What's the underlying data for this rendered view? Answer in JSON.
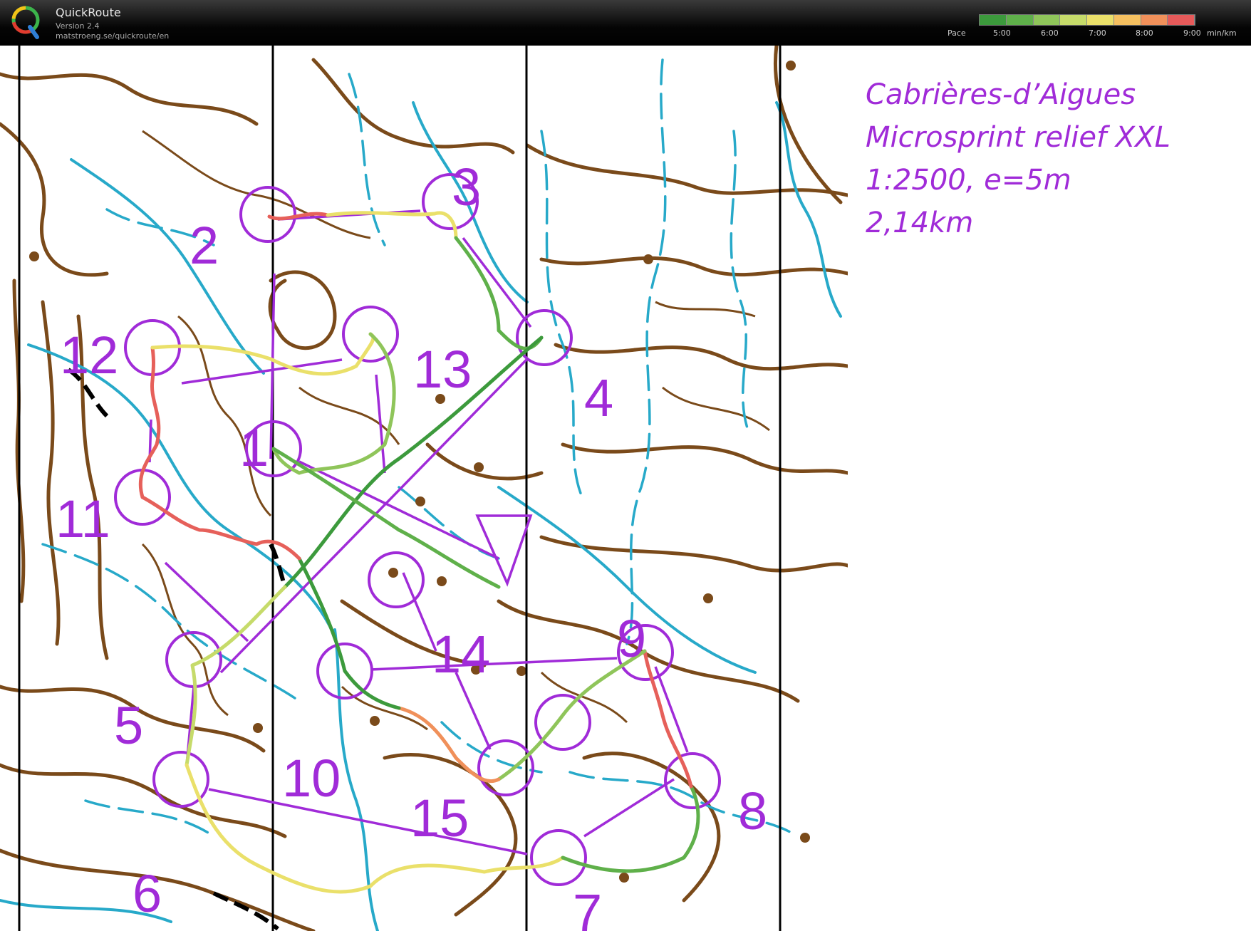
{
  "app": {
    "name": "QuickRoute",
    "version": "Version 2.4",
    "url": "matstroeng.se/quickroute/en"
  },
  "pace_legend": {
    "label": "Pace",
    "ticks": [
      "5:00",
      "6:00",
      "7:00",
      "8:00",
      "9:00"
    ],
    "unit": "min/km",
    "colors": [
      "#3c9a3c",
      "#5fb04a",
      "#8fc55a",
      "#c6db6a",
      "#eae06a",
      "#f5c060",
      "#f0905a",
      "#e65a5a"
    ]
  },
  "map": {
    "title_lines": [
      "Cabrières-d’Aigues",
      "Microsprint relief XXL",
      "1:2500, e=5m",
      "2,14km"
    ],
    "course_color": "#a02bd8",
    "contour_color": "#7a4a1a",
    "water_color": "#27a9c9",
    "controls": [
      "1",
      "2",
      "3",
      "4",
      "5",
      "6",
      "7",
      "8",
      "9",
      "10",
      "11",
      "12",
      "13",
      "14",
      "15"
    ]
  }
}
